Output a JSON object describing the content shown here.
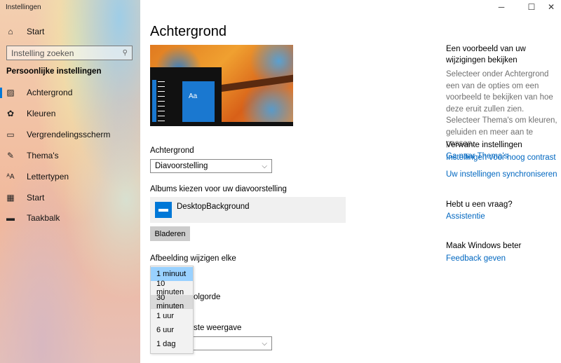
{
  "window": {
    "title": "Instellingen",
    "minimize": "─",
    "maximize": "☐",
    "close": "✕"
  },
  "sidebar": {
    "home": {
      "label": "Start",
      "icon": "home-icon"
    },
    "search_placeholder": "Instelling zoeken",
    "section_title": "Persoonlijke instellingen",
    "items": [
      {
        "label": "Achtergrond",
        "icon": "picture-icon",
        "selected": true
      },
      {
        "label": "Kleuren",
        "icon": "palette-icon"
      },
      {
        "label": "Vergrendelingsscherm",
        "icon": "lock-screen-icon"
      },
      {
        "label": "Thema's",
        "icon": "theme-icon"
      },
      {
        "label": "Lettertypen",
        "icon": "font-icon"
      },
      {
        "label": "Start",
        "icon": "start-icon"
      },
      {
        "label": "Taakbalk",
        "icon": "taskbar-icon"
      }
    ]
  },
  "main": {
    "title": "Achtergrond",
    "preview": {
      "tile_text": "Aa"
    },
    "background_label": "Achtergrond",
    "background_value": "Diavoorstelling",
    "albums_label": "Albums kiezen voor uw diavoorstelling",
    "album_name": "DesktopBackground",
    "browse_button": "Bladeren",
    "change_label": "Afbeelding wijzigen elke",
    "change_options": [
      "1 minuut",
      "10 minuten",
      "30 minuten",
      "1 uur",
      "6 uur",
      "1 dag"
    ],
    "change_selected": "1 minuut",
    "shuffle_label_visible": "olgorde",
    "fit_label_visible": "ste weergave"
  },
  "right": {
    "preview_heading": "Een voorbeeld van uw wijzigingen bekijken",
    "preview_text": "Selecteer onder Achtergrond een van de opties om een voorbeeld te bekijken van hoe deze eruit zullen zien. Selecteer Thema's om kleuren, geluiden en meer aan te passen.",
    "themes_link": "Ga naar Thema's",
    "related_heading": "Verwante instellingen",
    "related_links": [
      "Instellingen voor hoog contrast",
      "Uw instellingen synchroniseren"
    ],
    "question_heading": "Hebt u een vraag?",
    "help_link": "Assistentie",
    "improve_heading": "Maak Windows beter",
    "feedback_link": "Feedback geven"
  },
  "colors": {
    "accent": "#0078d7",
    "link": "#0067c0",
    "dropdown_selected": "#99d1ff"
  }
}
